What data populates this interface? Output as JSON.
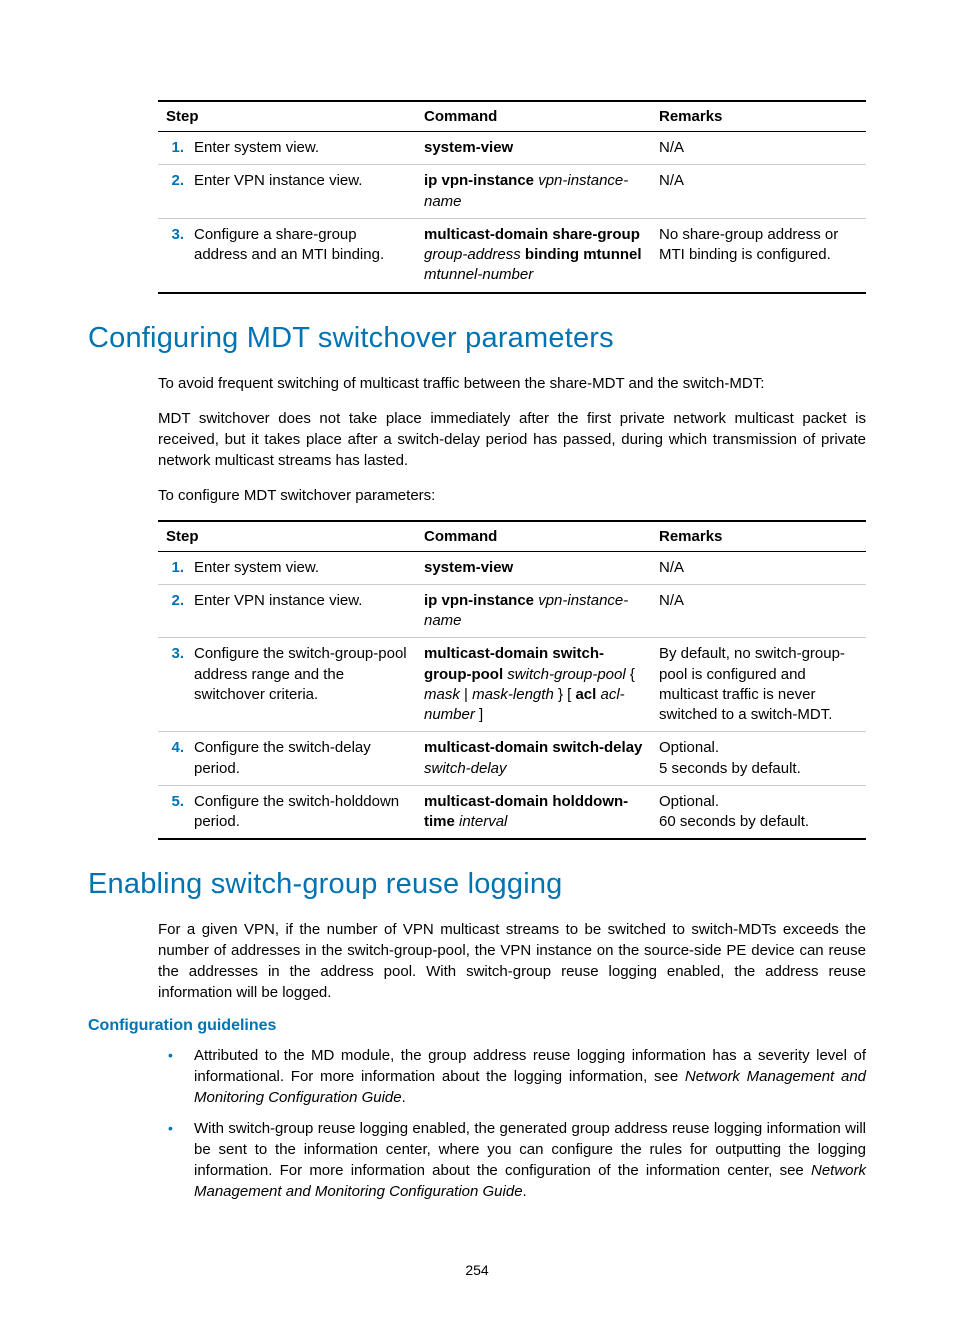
{
  "table1": {
    "headers": {
      "step": "Step",
      "command": "Command",
      "remarks": "Remarks"
    },
    "rows": [
      {
        "num": "1.",
        "step": "Enter system view.",
        "cmd_bold": "system-view",
        "cmd_italic_after": "",
        "remarks": "N/A"
      },
      {
        "num": "2.",
        "step": "Enter VPN instance view.",
        "cmd_bold": "ip vpn-instance",
        "cmd_italic_after": " vpn-instance-name",
        "remarks": "N/A"
      },
      {
        "num": "3.",
        "step": "Configure a share-group address and an MTI binding.",
        "cmd_bold1": "multicast-domain share-group",
        "cmd_italic1": " group-address",
        "cmd_bold2": " binding mtunnel",
        "cmd_italic2": " mtunnel-number",
        "remarks": "No share-group address or MTI binding is configured."
      }
    ]
  },
  "heading1": "Configuring MDT switchover parameters",
  "para1": "To avoid frequent switching of multicast traffic between the share-MDT and the switch-MDT:",
  "para2": "MDT switchover does not take place immediately after the first private network multicast packet is received, but it takes place after a switch-delay period has passed, during which transmission of private network multicast streams has lasted.",
  "para3": "To configure MDT switchover parameters:",
  "table2": {
    "headers": {
      "step": "Step",
      "command": "Command",
      "remarks": "Remarks"
    },
    "rows": [
      {
        "num": "1.",
        "step": "Enter system view.",
        "cmd_bold": "system-view",
        "remarks": "N/A"
      },
      {
        "num": "2.",
        "step": "Enter VPN instance view.",
        "cmd_bold": "ip vpn-instance",
        "cmd_italic_after": " vpn-instance-name",
        "remarks": "N/A"
      },
      {
        "num": "3.",
        "step": "Configure the switch-group-pool address range and the switchover criteria.",
        "cmd_bold1": "multicast-domain switch-group-pool",
        "cmd_italic1": " switch-group-pool",
        "cmd_plain1": " { ",
        "cmd_italic2": "mask",
        "cmd_plain2": " | ",
        "cmd_italic3": "mask-length",
        "cmd_plain3": " } [ ",
        "cmd_bold2": "acl",
        "cmd_italic4": " acl-number",
        "cmd_plain4": " ]",
        "remarks": "By default, no switch-group-pool is configured and multicast traffic is never switched to a switch-MDT."
      },
      {
        "num": "4.",
        "step": "Configure the switch-delay period.",
        "cmd_bold": "multicast-domain switch-delay",
        "cmd_italic_after": " switch-delay",
        "remarks_l1": "Optional.",
        "remarks_l2": "5 seconds by default."
      },
      {
        "num": "5.",
        "step": "Configure the switch-holddown period.",
        "cmd_bold": "multicast-domain holddown-time",
        "cmd_italic_after": " interval",
        "remarks_l1": "Optional.",
        "remarks_l2": "60 seconds by default."
      }
    ]
  },
  "heading2": "Enabling switch-group reuse logging",
  "para4": "For a given VPN, if the number of VPN multicast streams to be switched to switch-MDTs exceeds the number of addresses in the switch-group-pool, the VPN instance on the source-side PE device can reuse the addresses in the address pool. With switch-group reuse logging enabled, the address reuse information will be logged.",
  "subhead1": "Configuration guidelines",
  "bullet1_a": "Attributed to the MD module, the group address reuse logging information has a severity level of informational. For more information about the logging information, see ",
  "bullet1_i": "Network Management and Monitoring Configuration Guide",
  "bullet1_b": ".",
  "bullet2_a": "With switch-group reuse logging enabled, the generated group address reuse logging information will be sent to the information center, where you can configure the rules for outputting the logging information. For more information about the configuration of the information center, see ",
  "bullet2_i": "Network Management and Monitoring Configuration Guide",
  "bullet2_b": ".",
  "page_number": "254"
}
